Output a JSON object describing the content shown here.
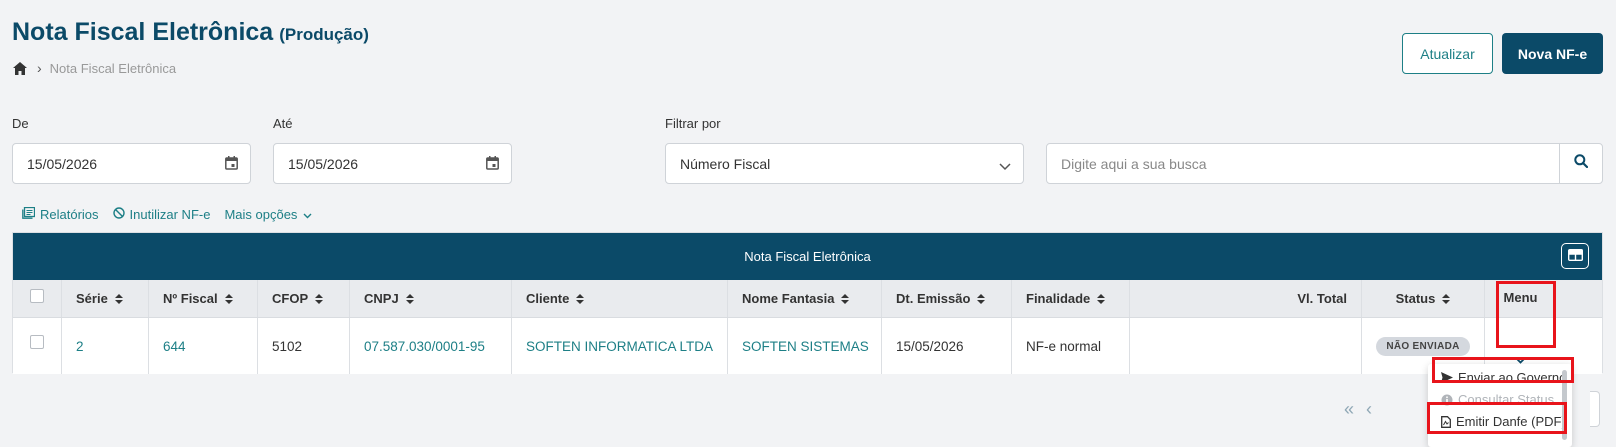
{
  "header": {
    "title": "Nota Fiscal Eletrônica",
    "env": "(Produção)",
    "breadcrumb": [
      "Nota Fiscal Eletrônica"
    ],
    "refresh_label": "Atualizar",
    "new_label": "Nova NF-e"
  },
  "filters": {
    "from_label": "De",
    "from_value": "15/05/2026",
    "to_label": "Até",
    "to_value": "15/05/2026",
    "filter_by_label": "Filtrar por",
    "filter_by_value": "Número Fiscal",
    "search_placeholder": "Digite aqui a sua busca"
  },
  "actions": {
    "reports": "Relatórios",
    "disable": "Inutilizar NF-e",
    "more": "Mais opções"
  },
  "grid": {
    "title": "Nota Fiscal Eletrônica",
    "columns": {
      "serie": "Série",
      "numero": "Nº Fiscal",
      "cfop": "CFOP",
      "cnpj": "CNPJ",
      "cliente": "Cliente",
      "fantasia": "Nome Fantasia",
      "emissao": "Dt. Emissão",
      "finalidade": "Finalidade",
      "total": "Vl. Total",
      "status": "Status",
      "menu": "Menu"
    },
    "rows": [
      {
        "serie": "2",
        "numero": "644",
        "cfop": "5102",
        "cnpj": "07.587.030/0001-95",
        "cliente": "SOFTEN INFORMATICA LTDA",
        "fantasia": "SOFTEN SISTEMAS",
        "emissao": "15/05/2026",
        "finalidade": "NF-e normal",
        "status": "NÃO ENVIADA"
      }
    ]
  },
  "row_menu": {
    "send": "Enviar ao Governo",
    "status": "Consultar Status",
    "danfe": "Emitir Danfe (PDF)"
  },
  "pager": {
    "first": "«",
    "prev": "‹"
  },
  "colors": {
    "primary": "#0b4a68",
    "accent": "#1d7f86",
    "highlight": "#e8141b"
  }
}
